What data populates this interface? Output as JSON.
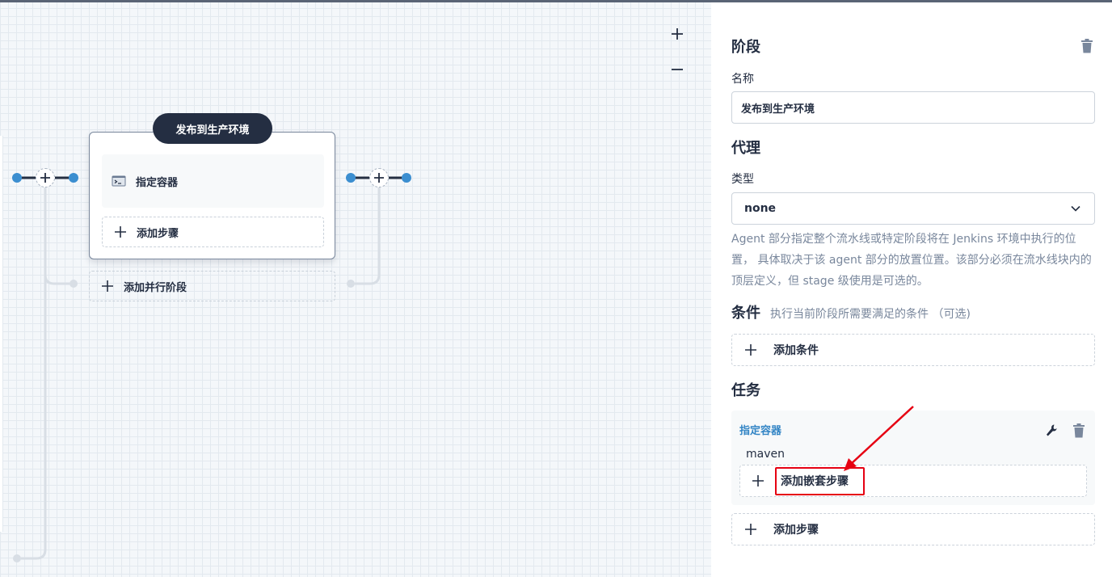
{
  "canvas": {
    "stage_title": "发布到生产环境",
    "step_label": "指定容器",
    "add_step_label": "添加步骤",
    "add_parallel_label": "添加并行阶段",
    "icons": {
      "zoom_in": "plus-icon",
      "zoom_out": "minus-icon",
      "step": "terminal-icon",
      "add": "plus-icon"
    }
  },
  "panel": {
    "stage_heading": "阶段",
    "name_label": "名称",
    "name_value": "发布到生产环境",
    "agent_heading": "代理",
    "type_label": "类型",
    "type_value": "none",
    "agent_description": "Agent 部分指定整个流水线或特定阶段将在 Jenkins 环境中执行的位置， 具体取决于该 agent 部分的放置位置。该部分必须在流水线块内的顶层定义，但 stage 级使用是可选的。",
    "condition_heading": "条件",
    "condition_hint": "执行当前阶段所需要满足的条件 （可选)",
    "add_condition_label": "添加条件",
    "task_heading": "任务",
    "task": {
      "name": "指定容器",
      "value": "maven",
      "add_nested_label": "添加嵌套步骤"
    },
    "add_step_label": "添加步骤"
  },
  "colors": {
    "dark": "#242e42",
    "accent_blue": "#3385c5",
    "node_blue": "#3b8ed0",
    "muted": "#79879c",
    "annotation_red": "#e60012"
  }
}
